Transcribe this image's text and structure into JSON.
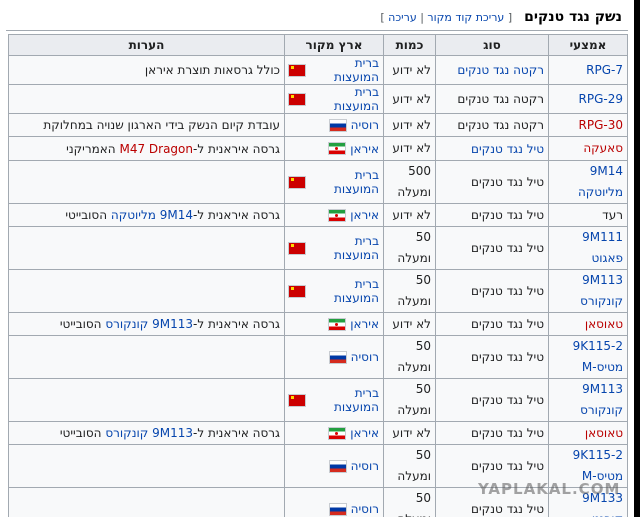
{
  "section": {
    "title": "נשק נגד טנקים",
    "edit_source": "עריכת קוד מקור",
    "separator": "|",
    "edit": "עריכה",
    "bracket_open": "[",
    "bracket_close": "]"
  },
  "columns": {
    "name": "אמצעי",
    "type": "סוג",
    "quantity": "כמות",
    "origin": "ארץ מקור",
    "notes": "הערות"
  },
  "rows": [
    {
      "name": [
        "RPG-7"
      ],
      "name_style": "link",
      "type": "רקטה נגד טנקים",
      "type_link": true,
      "qty": [
        "לא ידוע"
      ],
      "flag": "ussr",
      "origin": "ברית המועצות",
      "notes": "כולל גרסאות תוצרת איראן",
      "height": 24
    },
    {
      "name": [
        "RPG-29"
      ],
      "name_style": "link",
      "type": "רקטה נגד טנקים",
      "type_link": false,
      "qty": [
        "לא ידוע"
      ],
      "flag": "ussr",
      "origin": "ברית המועצות",
      "notes": "",
      "height": 23
    },
    {
      "name": [
        "RPG-30"
      ],
      "name_style": "red",
      "type": "רקטה נגד טנקים",
      "type_link": false,
      "qty": [
        "לא ידוע"
      ],
      "flag": "russia",
      "origin": "רוסיה",
      "notes": "עובדת קיום הנשק בידי הארגון שנויה במחלוקת",
      "height": 23
    },
    {
      "name": [
        "סאעקה"
      ],
      "name_style": "red",
      "type": "טיל נגד טנקים",
      "type_link": true,
      "qty": [
        "לא ידוע"
      ],
      "flag": "iran",
      "origin": "איראן",
      "notes_parts": [
        "גרסה איראנית ל-",
        "M47 Dragon",
        " האמריקני"
      ],
      "notes_style": "red",
      "height": 24
    },
    {
      "name": [
        "9M14",
        "מליוטקה"
      ],
      "name_style": "link",
      "type": "טיל נגד טנקים",
      "type_link": false,
      "qty": [
        "500",
        "ומעלה"
      ],
      "flag": "ussr",
      "origin": "ברית המועצות",
      "notes": "",
      "height": 43
    },
    {
      "name": [
        "רעד"
      ],
      "name_style": "plain",
      "type": "טיל נגד טנקים",
      "type_link": false,
      "qty": [
        "לא ידוע"
      ],
      "flag": "iran",
      "origin": "איראן",
      "notes_parts": [
        "גרסה איראנית ל-",
        "9M14 מליוטקה",
        " הסובייטי"
      ],
      "notes_style": "link",
      "height": 23
    },
    {
      "name": [
        "9M111",
        "פאגוט"
      ],
      "name_style": "link",
      "type": "טיל נגד טנקים",
      "type_link": false,
      "qty": [
        "50",
        "ומעלה"
      ],
      "flag": "ussr",
      "origin": "ברית המועצות",
      "notes": "",
      "height": 42
    },
    {
      "name": [
        "9M113",
        "קונקורס"
      ],
      "name_style": "link",
      "type": "טיל נגד טנקים",
      "type_link": false,
      "qty": [
        "50",
        "ומעלה"
      ],
      "flag": "ussr",
      "origin": "ברית המועצות",
      "notes": "",
      "height": 43
    },
    {
      "name": [
        "טאוסאן"
      ],
      "name_style": "red",
      "type": "טיל נגד טנקים",
      "type_link": false,
      "qty": [
        "לא ידוע"
      ],
      "flag": "iran",
      "origin": "איראן",
      "notes_parts": [
        "גרסה איראנית ל-",
        "9M113 קונקורס",
        " הסובייטי"
      ],
      "notes_style": "link",
      "height": 23
    },
    {
      "name": [
        "9K115-2",
        "מטיס-M"
      ],
      "name_style": "link",
      "type": "טיל נגד טנקים",
      "type_link": false,
      "qty": [
        "50",
        "ומעלה"
      ],
      "flag": "russia",
      "origin": "רוסיה",
      "notes": "",
      "height": 43
    },
    {
      "name": [
        "9M113",
        "קונקורס"
      ],
      "name_style": "link",
      "type": "טיל נגד טנקים",
      "type_link": false,
      "qty": [
        "50",
        "ומעלה"
      ],
      "flag": "ussr",
      "origin": "ברית המועצות",
      "notes": "",
      "height": 43
    },
    {
      "name": [
        "טאוסאן"
      ],
      "name_style": "red",
      "type": "טיל נגד טנקים",
      "type_link": false,
      "qty": [
        "לא ידוע"
      ],
      "flag": "iran",
      "origin": "איראן",
      "notes_parts": [
        "גרסה איראנית ל-",
        "9M113 קונקורס",
        " הסובייטי"
      ],
      "notes_style": "link",
      "height": 23
    },
    {
      "name": [
        "9K115-2",
        "מטיס-M"
      ],
      "name_style": "link",
      "type": "טיל נגד טנקים",
      "type_link": false,
      "qty": [
        "50",
        "ומעלה"
      ],
      "flag": "russia",
      "origin": "רוסיה",
      "notes": "",
      "height": 43
    },
    {
      "name": [
        "9M133",
        "קורנט"
      ],
      "name_style": "link",
      "type": "טיל נגד טנקים",
      "type_link": false,
      "qty": [
        "50",
        "ומעלה"
      ],
      "flag": "russia",
      "origin": "רוסיה",
      "notes": "",
      "height": 43
    }
  ],
  "watermark": "YAPLAKAL.COM"
}
